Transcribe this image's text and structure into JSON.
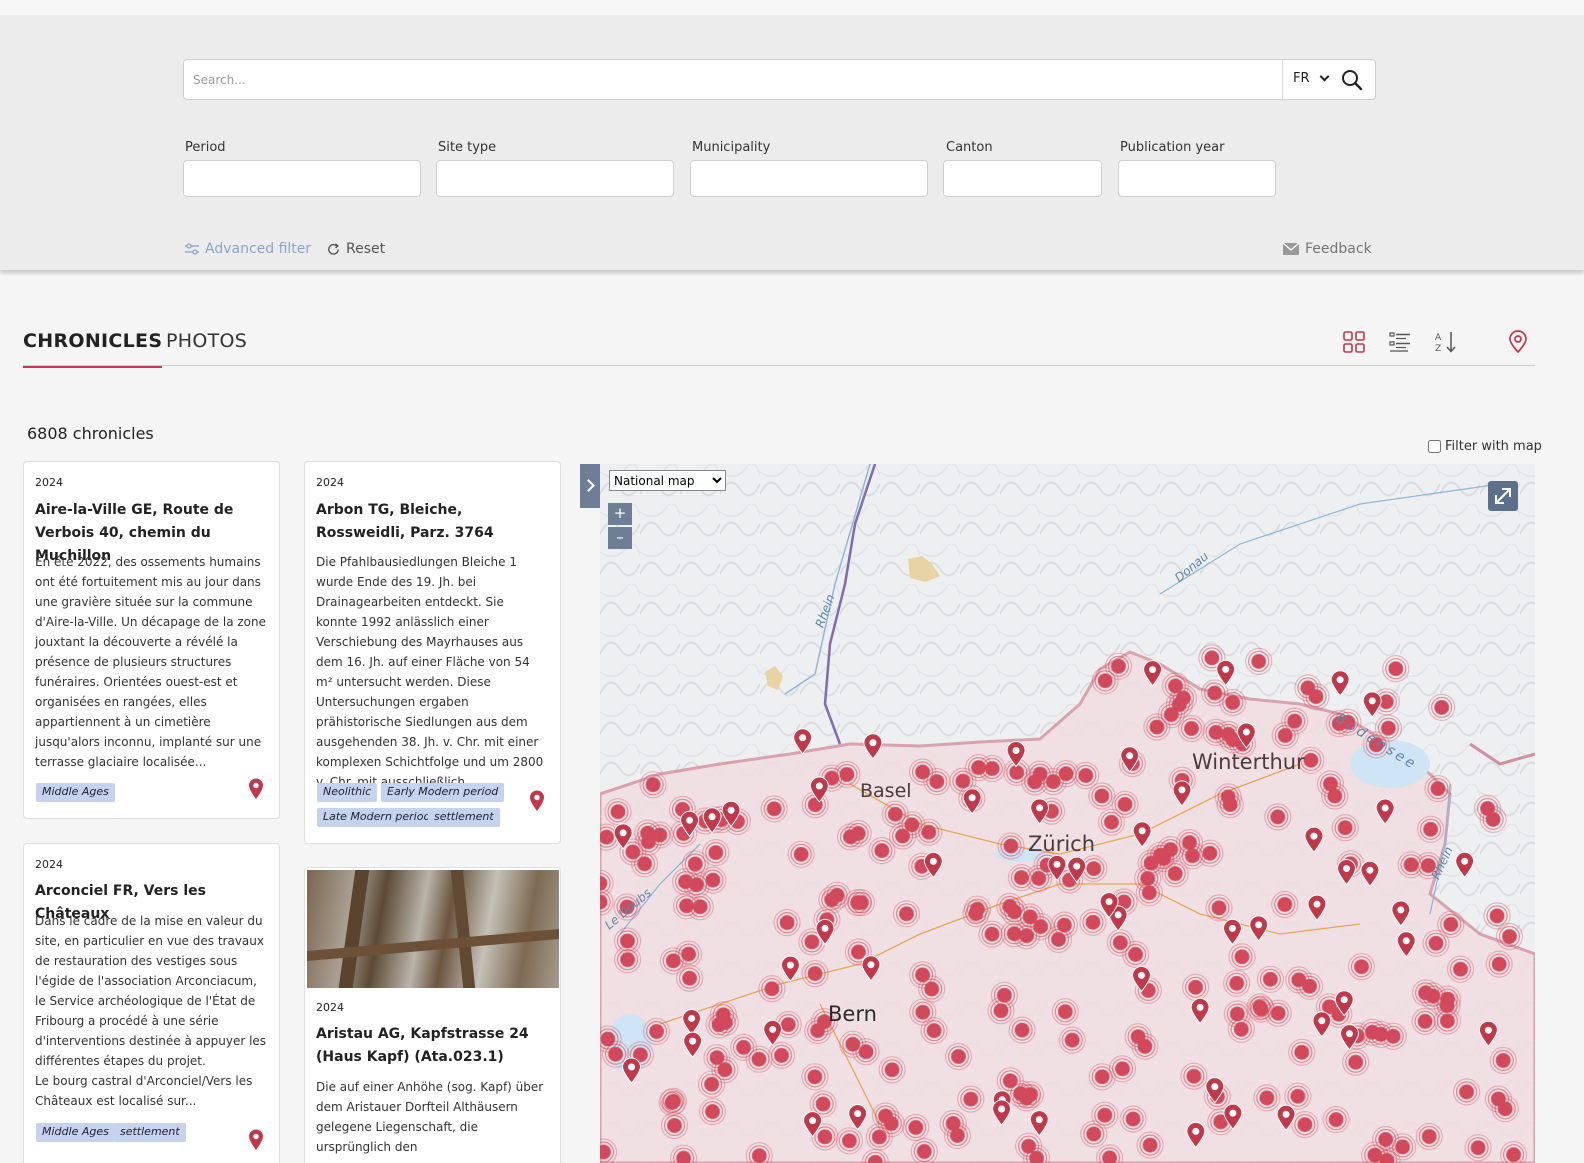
{
  "search": {
    "placeholder": "Search...",
    "language": "FR"
  },
  "filters": {
    "period_label": "Period",
    "site_type_label": "Site type",
    "municipality_label": "Municipality",
    "canton_label": "Canton",
    "publication_year_label": "Publication year"
  },
  "actions": {
    "advanced_filter": "Advanced filter",
    "reset": "Reset",
    "feedback": "Feedback"
  },
  "tabs": {
    "chronicles": "CHRONICLES",
    "photos": "PHOTOS"
  },
  "results": {
    "count": "6808 chronicles",
    "filter_with_map": "Filter with map"
  },
  "cards": [
    {
      "year": "2024",
      "title": "Aire-la-Ville GE, Route de Verbois 40, chemin du Muchillon",
      "excerpt": "En été 2022, des ossements humains ont été fortuitement mis au jour dans une gravière située sur la commune d'Aire-la-Ville. Un décapage de la zone jouxtant la découverte a révélé la présence de plusieurs structures funéraires. Orientées ouest-est et organisées en rangées, elles appartiennent à un cimetière jusqu'alors inconnu, implanté sur une terrasse glaciaire localisée...",
      "tags": [
        "Middle Ages"
      ]
    },
    {
      "year": "2024",
      "title": "Arbon TG, Bleiche, Rossweidli, Parz. 3764",
      "excerpt": "Die Pfahlbausiedlungen Bleiche 1 wurde Ende des 19. Jh. bei Drainagearbeiten entdeckt. Sie konnte 1992 anlässlich einer Verschiebung des Mayrhauses aus dem 16. Jh. auf einer Fläche von 54 m² untersucht werden. Diese Untersuchungen ergaben prähistorische Siedlungen aus dem ausgehenden 38. Jh. v. Chr. mit einer komplexen Schichtfolge und um 2800 v. Chr. mit ausschließlich...",
      "tags": [
        "Neolithic",
        "Early Modern period",
        "Late Modern period",
        "settlement"
      ]
    },
    {
      "year": "2024",
      "title": "Arconciel FR, Vers les Châteaux",
      "excerpt": "Dans le cadre de la mise en valeur du site, en particulier en vue des travaux de restauration des vestiges sous l'égide de l'association Arconciacum, le Service archéologique de l'État de Fribourg a procédé à une série d'interventions destinée à appuyer les différentes étapes du projet.\nLe bourg castral d'Arconciel/Vers les Châteaux est localisé sur...",
      "tags": [
        "Middle Ages",
        "settlement"
      ]
    },
    {
      "year": "2024",
      "title": "Aristau AG, Kapfstrasse 24 (Haus Kapf) (Ata.023.1)",
      "excerpt": "Die auf einer Anhöhe (sog. Kapf) über dem Aristauer Dorfteil Althäusern gelegene Liegenschaft, die ursprünglich den",
      "tags": []
    }
  ],
  "map": {
    "layer_options": [
      "National map"
    ],
    "zoom_in": "+",
    "zoom_out": "–",
    "labels": {
      "basel": "Basel",
      "zurich": "Zürich",
      "winterthur": "Winterthur",
      "bern": "Bern",
      "rhein": "Rhein",
      "rhein2": "Rhein",
      "donau": "Donau",
      "bodensee": "Bodensee",
      "le_doubs": "Le Doubs"
    }
  },
  "colors": {
    "accent": "#c0394b",
    "tag_bg": "#c6d2ee",
    "map_control": "#6e7f95",
    "link": "#8aa4cc"
  }
}
